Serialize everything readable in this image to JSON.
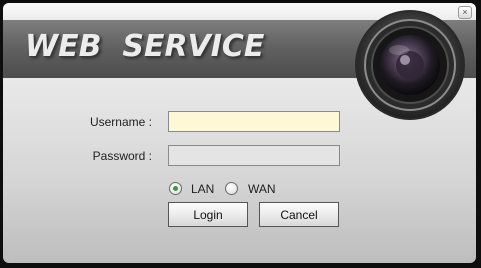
{
  "window": {
    "close_glyph": "×"
  },
  "banner": {
    "title": "WEB  SERVICE"
  },
  "form": {
    "username_label": "Username :",
    "username_value": "",
    "password_label": "Password :",
    "password_value": "",
    "network_options": [
      {
        "label": "LAN",
        "selected": true
      },
      {
        "label": "WAN",
        "selected": false
      }
    ],
    "login_label": "Login",
    "cancel_label": "Cancel"
  },
  "colors": {
    "radio_selected": "#2f9d3a",
    "username_field_bg": "#fff8d7",
    "banner": "#626262"
  },
  "icons": {
    "banner_image": "camera-lens-icon",
    "close": "close-icon"
  }
}
